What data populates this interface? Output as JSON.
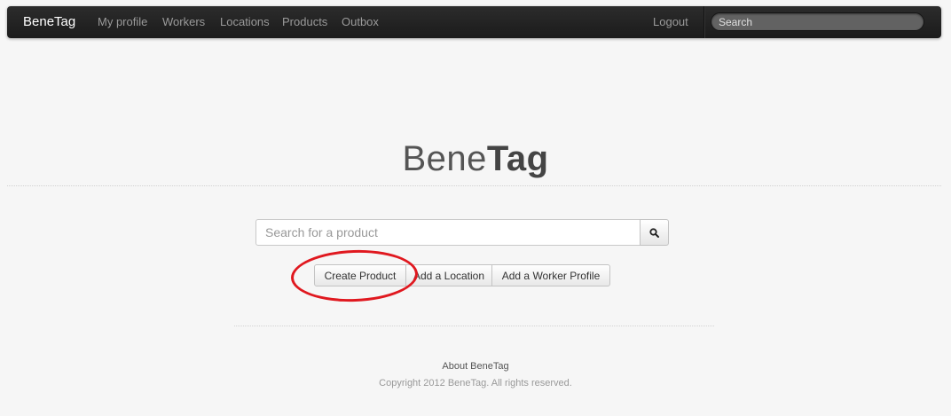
{
  "navbar": {
    "brand": "BeneTag",
    "links": [
      "My profile",
      "Workers",
      "Locations",
      "Products",
      "Outbox"
    ],
    "logout": "Logout",
    "search_placeholder": "Search"
  },
  "hero": {
    "title_light": "Bene",
    "title_bold": "Tag"
  },
  "product_search": {
    "placeholder": "Search for a product",
    "button_icon": "search-icon"
  },
  "actions": {
    "create_product": "Create Product",
    "add_location": "Add a Location",
    "add_worker": "Add a Worker Profile"
  },
  "annotation": {
    "highlight_color": "#e0181f"
  },
  "footer": {
    "about": "About BeneTag",
    "copyright": "Copyright 2012 BeneTag. All rights reserved."
  }
}
